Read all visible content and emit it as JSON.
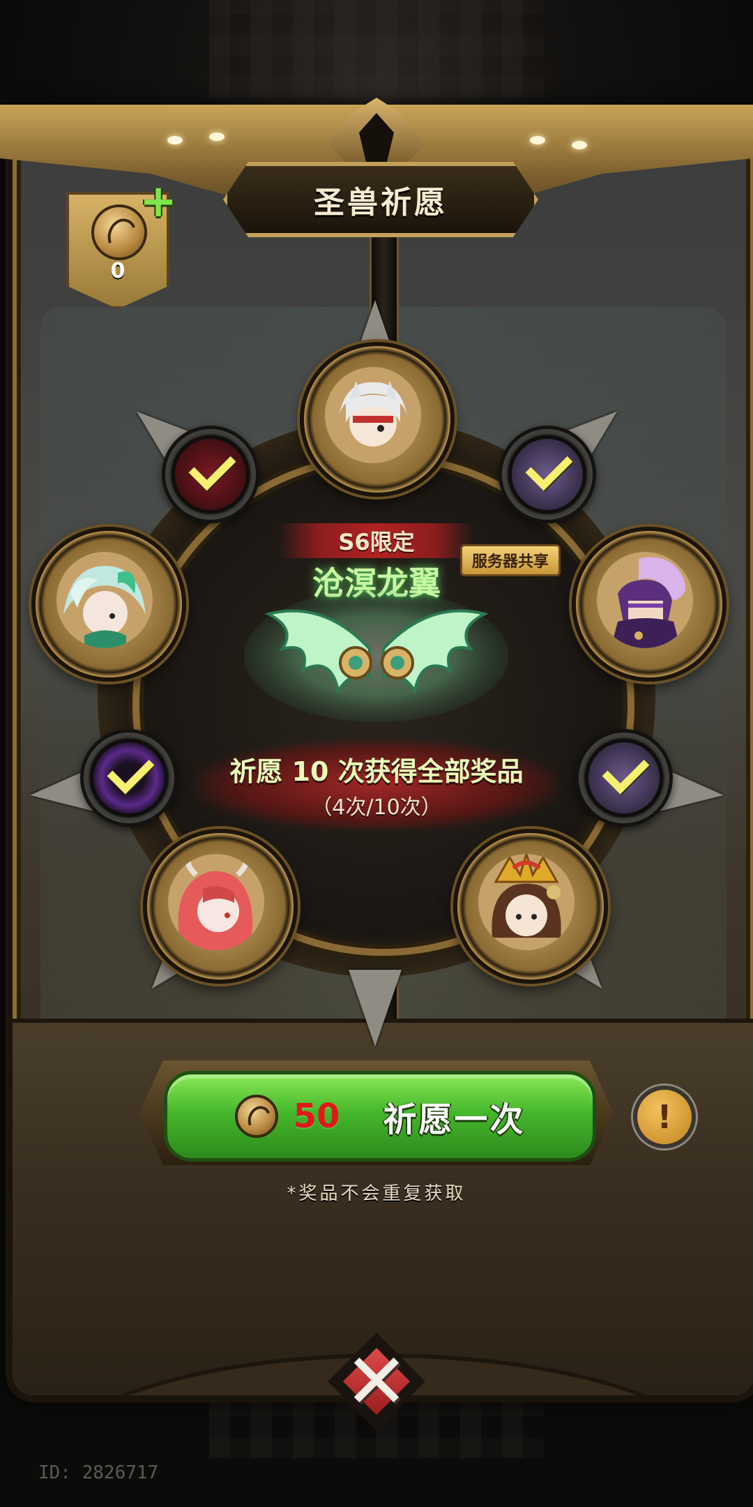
{
  "header": {
    "title": "圣兽祈愿"
  },
  "currency": {
    "amount": "0",
    "icon": "wish-coin-icon",
    "add_icon": "plus-icon"
  },
  "wheel": {
    "slots_big": [
      {
        "name": "white-wolf-hero",
        "icon": "white-wolf-hero-portrait"
      },
      {
        "name": "jade-dragon-hero",
        "icon": "jade-dragon-hero-portrait"
      },
      {
        "name": "purple-armor-hero",
        "icon": "purple-armor-hero-portrait"
      },
      {
        "name": "red-horn-hero",
        "icon": "red-horn-hero-portrait"
      },
      {
        "name": "golden-crown-hero",
        "icon": "golden-crown-hero-portrait"
      }
    ],
    "slots_small": [
      {
        "name": "red-demon-item",
        "claimed": true
      },
      {
        "name": "purple-tome-item",
        "claimed": true
      },
      {
        "name": "shadow-ring-item",
        "claimed": true
      },
      {
        "name": "purple-tome-item-2",
        "claimed": true
      }
    ]
  },
  "featured": {
    "season_tag": "S6限定",
    "item_name": "沧溟龙翼",
    "shared_tag": "服务器共享",
    "wish_text": "祈愿 10 次获得全部奖品",
    "progress_text": "（4次/10次）",
    "progress_count": 4,
    "progress_total": 10
  },
  "action": {
    "cost": "50",
    "label": "祈愿一次",
    "info_icon": "info-icon"
  },
  "note": "*奖品不会重复获取",
  "footer": {
    "close_icon": "close-icon",
    "uid": "ID: 2826717"
  },
  "colors": {
    "accent_gold": "#c9a456",
    "button_green": "#46b72c",
    "cost_red": "#e01818",
    "check_yellow": "#f5f070"
  }
}
